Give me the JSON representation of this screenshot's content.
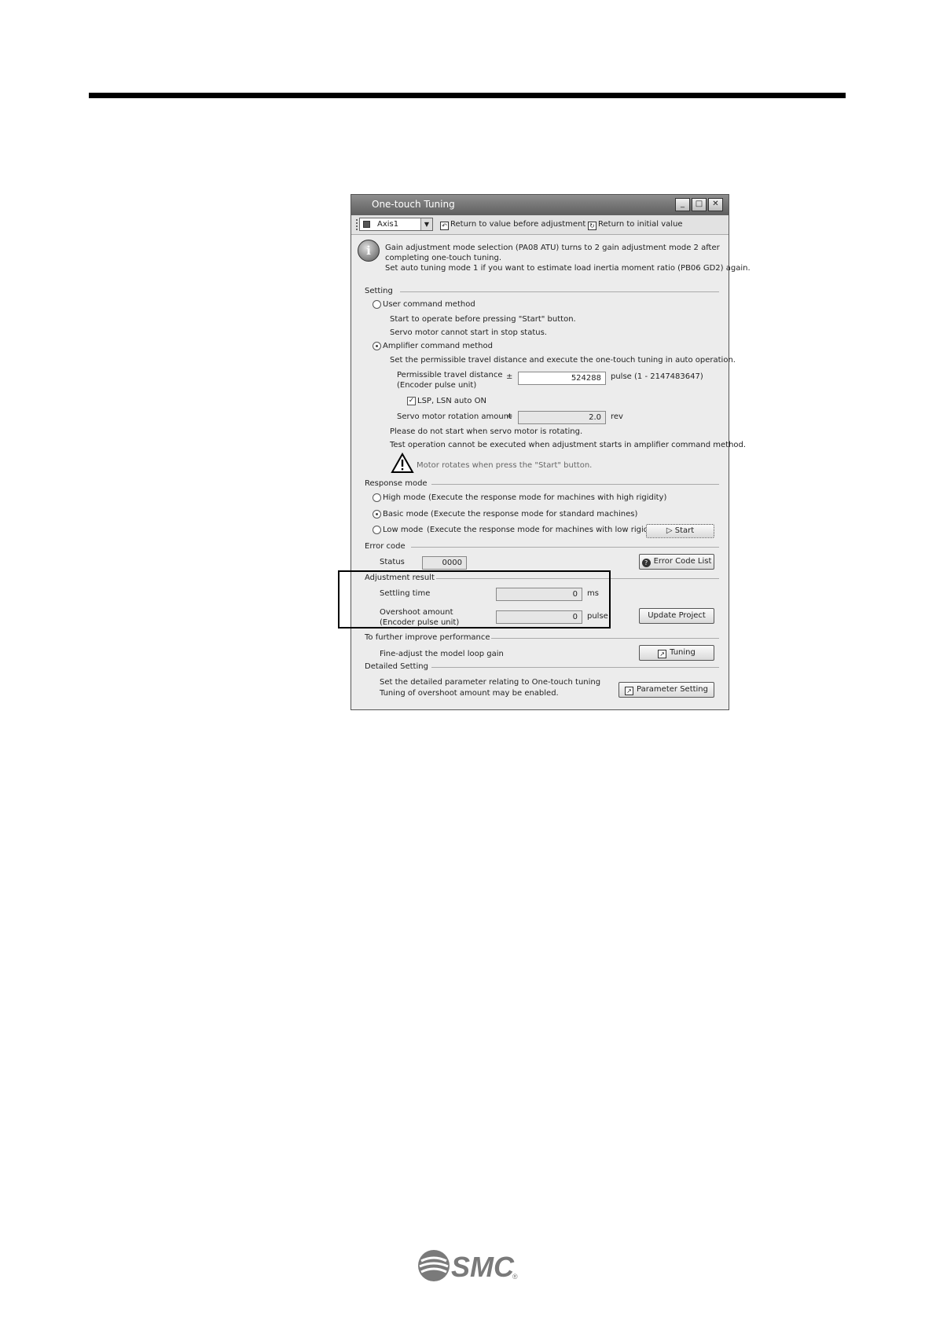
{
  "window": {
    "title": "One-touch Tuning",
    "controls": [
      "_",
      "□",
      "✕"
    ]
  },
  "toolbar": {
    "axis": "Axis1",
    "return_before_adjust": "Return to value before adjustment",
    "return_initial": "Return to initial value"
  },
  "info": {
    "line1": "Gain adjustment mode selection (PA08 ATU) turns to 2 gain adjustment mode 2 after",
    "line2": "completing one-touch tuning.",
    "line3": "Set auto tuning mode 1 if you want to estimate load inertia moment ratio (PB06 GD2) again."
  },
  "setting": {
    "label": "Setting",
    "user_cmd": "User command method",
    "user_desc1": "Start to operate before pressing \"Start\" button.",
    "user_desc2": "Servo motor cannot start in stop status.",
    "amp_cmd": "Amplifier command method",
    "amp_desc": "Set the permissible travel distance and execute the one-touch tuning in auto operation.",
    "travel_label1": "Permissible travel distance",
    "travel_label2": "(Encoder pulse unit)",
    "plusminus": "±",
    "travel_value": "524288",
    "travel_unit": "pulse (1 - 2147483647)",
    "lsp": "LSP, LSN auto ON",
    "rotation_label": "Servo motor rotation amount",
    "approx": "≈",
    "rotation_value": "2.0",
    "rotation_unit": "rev",
    "note1": "Please do not start when servo motor is rotating.",
    "note2": "Test operation cannot be executed when adjustment starts in amplifier command method.",
    "warning": "Motor rotates when press the \"Start\" button."
  },
  "response": {
    "label": "Response mode",
    "high": "High mode",
    "high_desc": "(Execute the response mode for machines with high rigidity)",
    "basic": "Basic mode",
    "basic_desc": "(Execute the response mode for standard machines)",
    "low": "Low mode",
    "low_desc": "(Execute the response mode for machines with low rigidity)",
    "start": "Start"
  },
  "error": {
    "label": "Error code",
    "status_label": "Status",
    "status_value": "0000",
    "list_btn": "Error Code List"
  },
  "result": {
    "label": "Adjustment result",
    "settling_label": "Settling time",
    "settling_value": "0",
    "settling_unit": "ms",
    "overshoot_label1": "Overshoot amount",
    "overshoot_label2": "(Encoder pulse unit)",
    "overshoot_value": "0",
    "overshoot_unit": "pulse",
    "update_btn": "Update Project"
  },
  "improve": {
    "label": "To further improve performance",
    "desc": "Fine-adjust the model loop gain",
    "btn": "Tuning"
  },
  "detailed": {
    "label": "Detailed Setting",
    "desc1": "Set the detailed parameter relating to One-touch tuning",
    "desc2": "Tuning of overshoot amount may be enabled.",
    "btn": "Parameter Setting"
  },
  "footer": {
    "logo_text": "SMC",
    "logo_mark": "®"
  }
}
